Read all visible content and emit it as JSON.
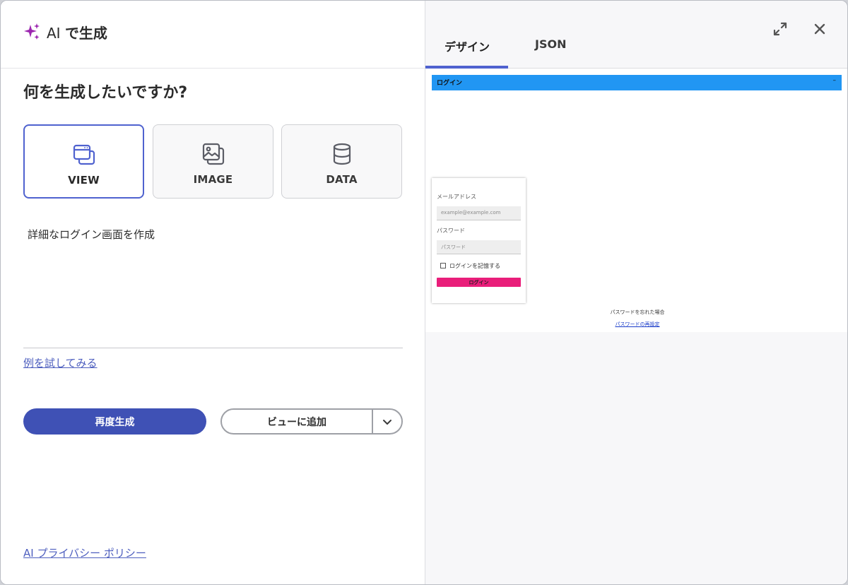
{
  "header": {
    "icon": "sparkles-icon",
    "title_prefix": "AI ",
    "title_main": "で生成"
  },
  "question": "何を生成したいですか?",
  "type_options": [
    {
      "label": "VIEW",
      "icon": "view-window-icon",
      "selected": true
    },
    {
      "label": "IMAGE",
      "icon": "image-icon",
      "selected": false
    },
    {
      "label": "DATA",
      "icon": "database-icon",
      "selected": false
    }
  ],
  "prompt": {
    "value": "詳細なログイン画面を作成"
  },
  "examples_link": "例を試してみる",
  "actions": {
    "regenerate_label": "再度生成",
    "add_to_view_label": "ビューに追加"
  },
  "privacy_link": "AI プライバシー ポリシー",
  "tabs": [
    {
      "label": "デザイン",
      "active": true
    },
    {
      "label": "JSON",
      "active": false
    }
  ],
  "preview": {
    "bar_title": "ログイン",
    "bar_min": "–",
    "email_label": "メールアドレス",
    "email_placeholder": "example@example.com",
    "password_label": "パスワード",
    "password_placeholder": "パスワード",
    "remember_label": "ログインを記憶する",
    "login_button": "ログイン",
    "forgot_text": "パスワードを忘れた場合",
    "reset_link": "パスワードの再設定"
  },
  "colors": {
    "accent": "#3f51b5",
    "selected_border": "#4f62cf",
    "link": "#4e5fbf",
    "sparkle": "#9c27b0",
    "preview_bar": "#2196f3",
    "preview_login": "#e91e7a"
  }
}
